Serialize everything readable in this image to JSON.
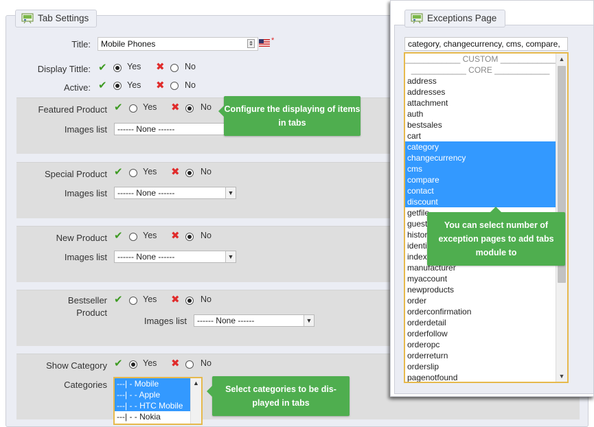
{
  "tab_settings": {
    "legend": "Tab Settings",
    "title_label": "Title:",
    "title_value": "Mobile Phones",
    "required_mark": "*",
    "display_title_label": "Display Tittle:",
    "active_label": "Active:",
    "yes": "Yes",
    "no": "No",
    "sections": {
      "featured": {
        "label": "Featured Product",
        "images_label": "Images list",
        "images_value": "------ None ------"
      },
      "special": {
        "label": "Special Product",
        "images_label": "Images list",
        "images_value": "------ None ------"
      },
      "new": {
        "label": "New Product",
        "images_label": "Images list",
        "images_value": "------ None ------"
      },
      "bestseller": {
        "label_line1": "Bestseller",
        "label_line2": "Product",
        "images_label": "Images list",
        "images_value": "------ None ------"
      }
    },
    "show_category_label": "Show Category",
    "categories_label": "Categories",
    "categories": [
      {
        "label": "---| - Mobile",
        "selected": true
      },
      {
        "label": "---| - - Apple",
        "selected": true
      },
      {
        "label": "---| - - HTC Mobile",
        "selected": true
      },
      {
        "label": "---| - - Nokia",
        "selected": false
      }
    ]
  },
  "tooltips": {
    "display_items": "Configure the displaying of items in tabs",
    "select_categories": "Select categories to be dis- played in tabs",
    "exception_pages": "You can select number of exception pages to add tabs module to"
  },
  "exceptions": {
    "legend": "Exceptions Page",
    "input_value": "category, changecurrency, cms, compare,",
    "separators": [
      "____________ CUSTOM ____________",
      "____________ CORE ____________"
    ],
    "items": [
      {
        "label": "address",
        "selected": false
      },
      {
        "label": "addresses",
        "selected": false
      },
      {
        "label": "attachment",
        "selected": false
      },
      {
        "label": "auth",
        "selected": false
      },
      {
        "label": "bestsales",
        "selected": false
      },
      {
        "label": "cart",
        "selected": false
      },
      {
        "label": "category",
        "selected": true
      },
      {
        "label": "changecurrency",
        "selected": true
      },
      {
        "label": "cms",
        "selected": true
      },
      {
        "label": "compare",
        "selected": true
      },
      {
        "label": "contact",
        "selected": true
      },
      {
        "label": "discount",
        "selected": true
      },
      {
        "label": "getfile",
        "selected": false
      },
      {
        "label": "guest",
        "selected": false
      },
      {
        "label": "histor",
        "selected": false
      },
      {
        "label": "identi",
        "selected": false
      },
      {
        "label": "index",
        "selected": false
      },
      {
        "label": "manufacturer",
        "selected": false
      },
      {
        "label": "myaccount",
        "selected": false
      },
      {
        "label": "newproducts",
        "selected": false
      },
      {
        "label": "order",
        "selected": false
      },
      {
        "label": "orderconfirmation",
        "selected": false
      },
      {
        "label": "orderdetail",
        "selected": false
      },
      {
        "label": "orderfollow",
        "selected": false
      },
      {
        "label": "orderopc",
        "selected": false
      },
      {
        "label": "orderreturn",
        "selected": false
      },
      {
        "label": "orderslip",
        "selected": false
      },
      {
        "label": "pagenotfound",
        "selected": false
      }
    ]
  },
  "colors": {
    "accent_tooltip": "#4fae4f",
    "selection": "#3399ff",
    "focus_border": "#e6b94c",
    "check": "#3e9b23",
    "cross": "#e02c2c"
  }
}
